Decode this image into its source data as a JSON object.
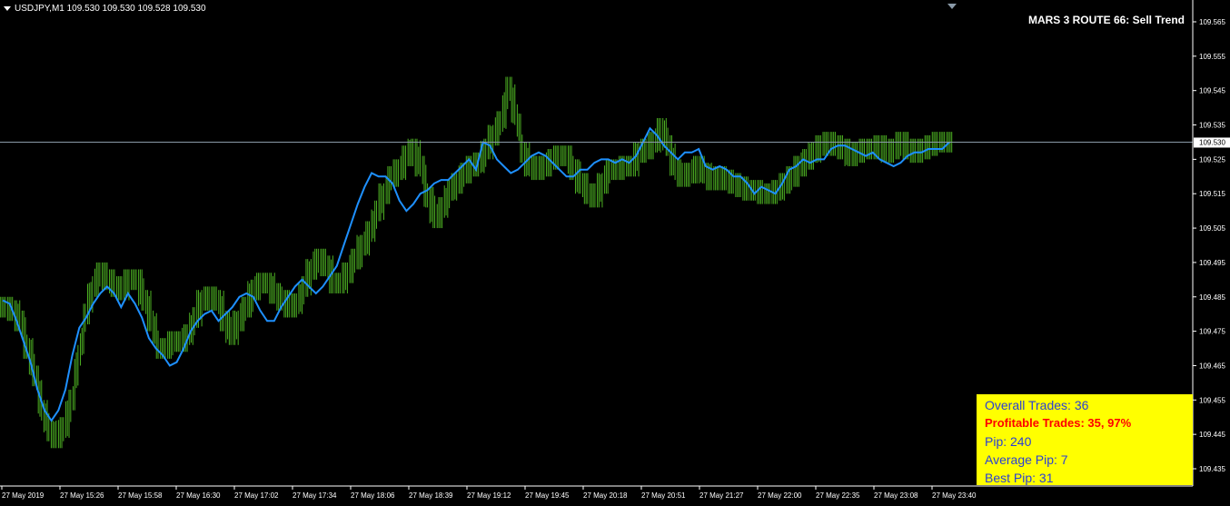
{
  "header": {
    "text": "USDJPY,M1  109.530 109.530 109.528 109.530"
  },
  "signal_label": "MARS 3 ROUTE 66: Sell Trend",
  "stats": {
    "overall": "Overall Trades: 36",
    "profitable": "Profitable Trades: 35, 97%",
    "pip": "Pip: 240",
    "avg": "Average Pip: 7",
    "best": "Best Pip: 31"
  },
  "colors": {
    "background": "#000000",
    "bars": "#4caf22",
    "ma_line": "#1e90ff",
    "price_line": "#8a9aa8",
    "axis": "#ffffff",
    "stats_bg": "#ffff00"
  },
  "chart_data": {
    "type": "line",
    "title": "",
    "xlabel": "",
    "ylabel": "",
    "ylim": [
      109.43,
      109.57
    ],
    "current_price": 109.53,
    "y_ticks": [
      "109.565",
      "109.555",
      "109.545",
      "109.535",
      "109.525",
      "109.515",
      "109.505",
      "109.495",
      "109.485",
      "109.475",
      "109.465",
      "109.455",
      "109.445",
      "109.435"
    ],
    "x_ticks": [
      "27 May 2019",
      "27 May 15:26",
      "27 May 15:58",
      "27 May 16:30",
      "27 May 17:02",
      "27 May 17:34",
      "27 May 18:06",
      "27 May 18:39",
      "27 May 19:12",
      "27 May 19:45",
      "27 May 20:18",
      "27 May 20:51",
      "27 May 21:27",
      "27 May 22:00",
      "27 May 22:35",
      "27 May 23:08",
      "27 May 23:40"
    ],
    "series": [
      {
        "type": "line",
        "values": [
          109.484,
          109.483,
          109.478,
          109.472,
          109.466,
          109.458,
          109.452,
          109.449,
          109.452,
          109.458,
          109.468,
          109.476,
          109.479,
          109.483,
          109.486,
          109.488,
          109.486,
          109.482,
          109.486,
          109.483,
          109.479,
          109.473,
          109.47,
          109.468,
          109.465,
          109.466,
          109.47,
          109.475,
          109.478,
          109.48,
          109.481,
          109.478,
          109.48,
          109.482,
          109.485,
          109.486,
          109.485,
          109.481,
          109.478,
          109.478,
          109.482,
          109.485,
          109.488,
          109.49,
          109.488,
          109.486,
          109.488,
          109.491,
          109.494,
          109.5,
          109.506,
          109.512,
          109.517,
          109.521,
          109.52,
          109.52,
          109.518,
          109.513,
          109.51,
          109.512,
          109.515,
          109.516,
          109.518,
          109.519,
          109.519,
          109.521,
          109.523,
          109.525,
          109.522,
          109.53,
          109.529,
          109.525,
          109.523,
          109.521,
          109.522,
          109.524,
          109.526,
          109.527,
          109.526,
          109.524,
          109.522,
          109.52,
          109.52,
          109.522,
          109.522,
          109.524,
          109.525,
          109.525,
          109.524,
          109.525,
          109.524,
          109.526,
          109.53,
          109.534,
          109.532,
          109.529,
          109.527,
          109.525,
          109.527,
          109.527,
          109.528,
          109.523,
          109.522,
          109.523,
          109.522,
          109.52,
          109.52,
          109.518,
          109.515,
          109.517,
          109.516,
          109.515,
          109.518,
          109.522,
          109.523,
          109.525,
          109.524,
          109.525,
          109.525,
          109.528,
          109.529,
          109.529,
          109.528,
          109.527,
          109.526,
          109.527,
          109.525,
          109.524,
          109.523,
          109.524,
          109.526,
          109.527,
          109.527,
          109.528,
          109.528,
          109.528,
          109.53
        ]
      },
      {
        "type": "bar",
        "values": [
          109.482,
          109.481,
          109.478,
          109.47,
          109.462,
          109.452,
          109.446,
          109.444,
          109.447,
          109.455,
          109.468,
          109.48,
          109.488,
          109.492,
          109.49,
          109.488,
          109.487,
          109.49,
          109.49,
          109.484,
          109.478,
          109.47,
          109.47,
          109.472,
          109.472,
          109.474,
          109.479,
          109.484,
          109.485,
          109.484,
          109.478,
          109.474,
          109.478,
          109.482,
          109.487,
          109.489,
          109.489,
          109.486,
          109.484,
          109.482,
          109.483,
          109.488,
          109.493,
          109.496,
          109.494,
          109.489,
          109.489,
          109.492,
          109.496,
          109.5,
          109.504,
          109.51,
          109.515,
          109.52,
          109.522,
          109.526,
          109.528,
          109.523,
          109.514,
          109.508,
          109.511,
          109.516,
          109.518,
          109.521,
          109.523,
          109.524,
          109.528,
          109.532,
          109.536,
          109.546,
          109.538,
          109.527,
          109.523,
          109.522,
          109.523,
          109.525,
          109.526,
          109.526,
          109.522,
          109.518,
          109.515,
          109.514,
          109.518,
          109.522,
          109.522,
          109.523,
          109.523,
          109.527,
          109.528,
          109.53,
          109.534,
          109.529,
          109.522,
          109.52,
          109.521,
          109.523,
          109.521,
          109.519,
          109.52,
          109.519,
          109.518,
          109.517,
          109.516,
          109.516,
          109.515,
          109.515,
          109.516,
          109.518,
          109.52,
          109.523,
          109.525,
          109.527,
          109.529,
          109.53,
          109.529,
          109.528,
          109.526,
          109.527,
          109.528,
          109.528,
          109.529,
          109.527,
          109.528,
          109.53,
          109.528,
          109.527,
          109.528,
          109.529,
          109.53,
          109.53,
          109.53
        ]
      }
    ]
  }
}
